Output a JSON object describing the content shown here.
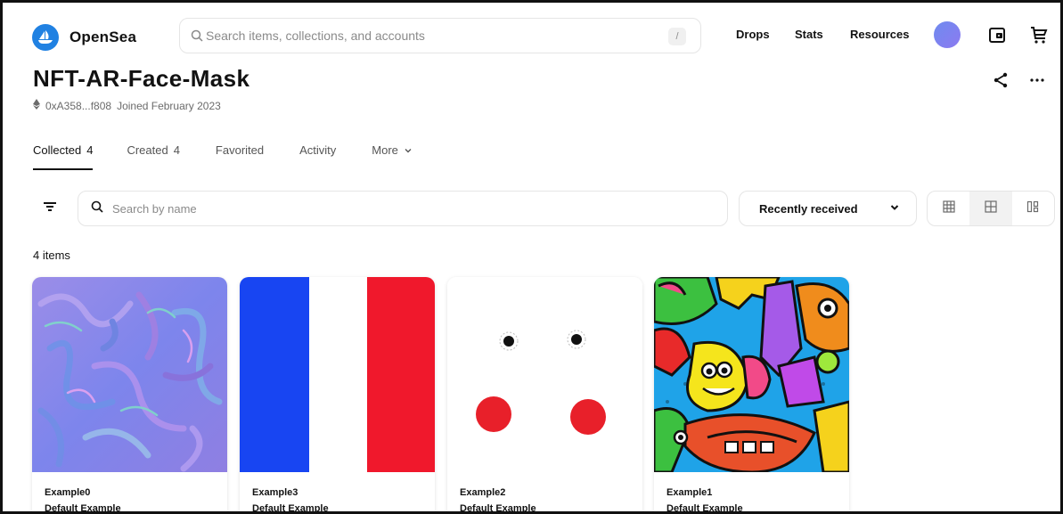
{
  "nav": {
    "brand": "OpenSea",
    "search_placeholder": "Search items, collections, and accounts",
    "search_shortcut": "/",
    "links": [
      "Drops",
      "Stats",
      "Resources"
    ]
  },
  "profile": {
    "name": "NFT-AR-Face-Mask",
    "address": "0xA358...f808",
    "joined": "Joined February 2023"
  },
  "tabs": [
    {
      "label": "Collected",
      "count": "4",
      "active": true
    },
    {
      "label": "Created",
      "count": "4",
      "active": false
    },
    {
      "label": "Favorited",
      "count": "",
      "active": false
    },
    {
      "label": "Activity",
      "count": "",
      "active": false
    },
    {
      "label": "More",
      "count": "",
      "active": false
    }
  ],
  "toolbar": {
    "search_placeholder": "Search by name",
    "sort_label": "Recently received"
  },
  "items_count": "4 items",
  "items": [
    {
      "name": "Example0",
      "collection": "Default Example",
      "art": "normal-map-texture"
    },
    {
      "name": "Example3",
      "collection": "Default Example",
      "art": "french-flag-stripes"
    },
    {
      "name": "Example2",
      "collection": "Default Example",
      "art": "face-eyes-cheeks"
    },
    {
      "name": "Example1",
      "collection": "Default Example",
      "art": "doodle-monsters"
    }
  ],
  "colors": {
    "brand_blue": "#2081e2",
    "flag_blue": "#1845f2",
    "flag_red": "#f0182c",
    "cheek_red": "#e8202a",
    "texture_purple": "#8a84e6"
  }
}
